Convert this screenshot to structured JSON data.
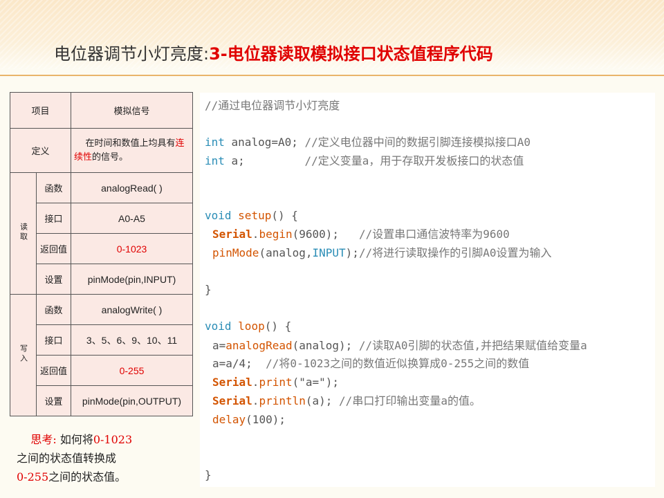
{
  "title": {
    "main": "电位器调节小灯亮度:",
    "sub": "3-电位器读取模拟接口状态值程序代码"
  },
  "table": {
    "header": [
      "项目",
      "模拟信号"
    ],
    "definition": {
      "label": "定义",
      "text_a": "在时间和数值上均具有",
      "text_red": "连续性",
      "text_b": "的信号。"
    },
    "read": {
      "group": "读取",
      "rows": [
        {
          "label": "函数",
          "value": "analogRead( )"
        },
        {
          "label": "接口",
          "value": "A0-A5"
        },
        {
          "label": "返回值",
          "value": "0-1023"
        },
        {
          "label": "设置",
          "value": "pinMode(pin,INPUT)"
        }
      ]
    },
    "write": {
      "group": "写入",
      "rows": [
        {
          "label": "函数",
          "value": "analogWrite( )"
        },
        {
          "label": "接口",
          "value": "3、5、6、9、10、11"
        },
        {
          "label": "返回值",
          "value": "0-255"
        },
        {
          "label": "设置",
          "value": "pinMode(pin,OUTPUT)"
        }
      ]
    }
  },
  "thinking": {
    "label": "思考:",
    "t1": " 如何将",
    "n1": "0-1023",
    "t2": "之间的状态值转换成",
    "n2": "0-255",
    "t3": "之间的状态值。"
  },
  "code": {
    "l1": "//通过电位器调节小灯亮度",
    "l2a": "int",
    "l2b": " analog=A0; ",
    "l2c": "//定义电位器中间的数据引脚连接模拟接口A0",
    "l3a": "int",
    "l3b": " a;         ",
    "l3c": "//定义变量a，用于存取开发板接口的状态值",
    "l4a": "void",
    "l4b": " ",
    "l4c": "setup",
    "l4d": "() {",
    "l5a": "Serial",
    "l5b": ".",
    "l5c": "begin",
    "l5d": "(9600);   ",
    "l5e": "//设置串口通信波特率为9600",
    "l6a": "pinMode",
    "l6b": "(analog,",
    "l6c": "INPUT",
    "l6d": ");",
    "l6e": "//将进行读取操作的引脚A0设置为输入",
    "l7": "}",
    "l8a": "void",
    "l8b": " ",
    "l8c": "loop",
    "l8d": "() {",
    "l9a": "a=",
    "l9b": "analogRead",
    "l9c": "(analog); ",
    "l9d": "//读取A0引脚的状态值,并把结果赋值给变量a",
    "l10a": "a=a/4;  ",
    "l10b": "//将0-1023之间的数值近似换算成0-255之间的数值",
    "l11a": "Serial",
    "l11b": ".",
    "l11c": "print",
    "l11d": "(\"a=\");",
    "l12a": "Serial",
    "l12b": ".",
    "l12c": "println",
    "l12d": "(a); ",
    "l12e": "//串口打印输出变量a的值。",
    "l13a": "delay",
    "l13b": "(100);",
    "l14": "}"
  }
}
